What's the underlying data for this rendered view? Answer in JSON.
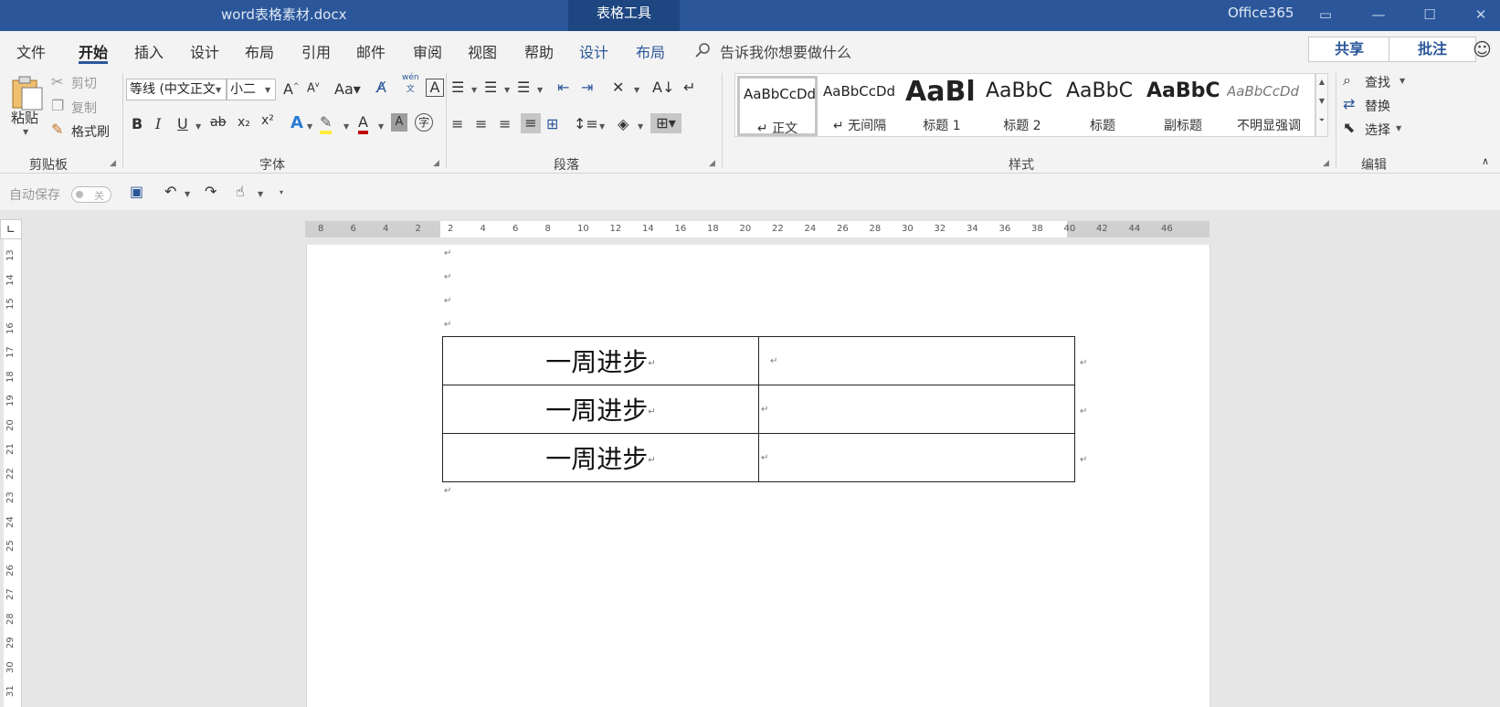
{
  "titlebar": {
    "doc_name": "word表格素材.docx",
    "context_tab": "表格工具",
    "brand": "Office365"
  },
  "menu": {
    "tabs": [
      "文件",
      "开始",
      "插入",
      "设计",
      "布局",
      "引用",
      "邮件",
      "审阅",
      "视图",
      "帮助",
      "设计",
      "布局"
    ],
    "active_tab": "开始",
    "tell_me": "告诉我你想要做什么",
    "share": "共享",
    "comment": "批注"
  },
  "ribbon": {
    "clipboard": {
      "label": "剪贴板",
      "paste": "粘贴",
      "cut": "剪切",
      "copy": "复制",
      "format_painter": "格式刷"
    },
    "font": {
      "label": "字体",
      "font_name": "等线 (中文正文",
      "font_size": "小二",
      "case": "Aa",
      "bold": "B",
      "italic": "I",
      "underline": "U",
      "strike": "ab",
      "subscript": "x₂",
      "superscript": "x²",
      "phonetic": "wén",
      "enclosed": "字"
    },
    "paragraph": {
      "label": "段落"
    },
    "styles": {
      "label": "样式",
      "items": [
        {
          "sample": "AaBbCcDd",
          "name": "↵ 正文"
        },
        {
          "sample": "AaBbCcDd",
          "name": "↵ 无间隔"
        },
        {
          "sample": "AaBl",
          "name": "标题 1"
        },
        {
          "sample": "AaBbC",
          "name": "标题 2"
        },
        {
          "sample": "AaBbC",
          "name": "标题"
        },
        {
          "sample": "AaBbC",
          "name": "副标题"
        },
        {
          "sample": "AaBbCcDd",
          "name": "不明显强调"
        }
      ]
    },
    "editing": {
      "label": "编辑",
      "find": "查找",
      "replace": "替换",
      "select": "选择"
    }
  },
  "qat": {
    "autosave": "自动保存",
    "toggle_state": "关"
  },
  "ruler": {
    "h_ticks": [
      "8",
      "6",
      "4",
      "2",
      "2",
      "4",
      "6",
      "8",
      "10",
      "12",
      "14",
      "16",
      "18",
      "20",
      "22",
      "24",
      "26",
      "28",
      "30",
      "32",
      "34",
      "36",
      "38",
      "40",
      "42",
      "44",
      "46"
    ],
    "v_ticks": [
      "13",
      "14",
      "15",
      "16",
      "17",
      "18",
      "19",
      "20",
      "21",
      "22",
      "23",
      "24",
      "25",
      "26",
      "27",
      "28",
      "29",
      "30",
      "31"
    ]
  },
  "document": {
    "table": [
      {
        "c1": "一周进步",
        "c2": ""
      },
      {
        "c1": "一周进步",
        "c2": ""
      },
      {
        "c1": "一周进步",
        "c2": ""
      }
    ],
    "para_mark": "↵"
  }
}
